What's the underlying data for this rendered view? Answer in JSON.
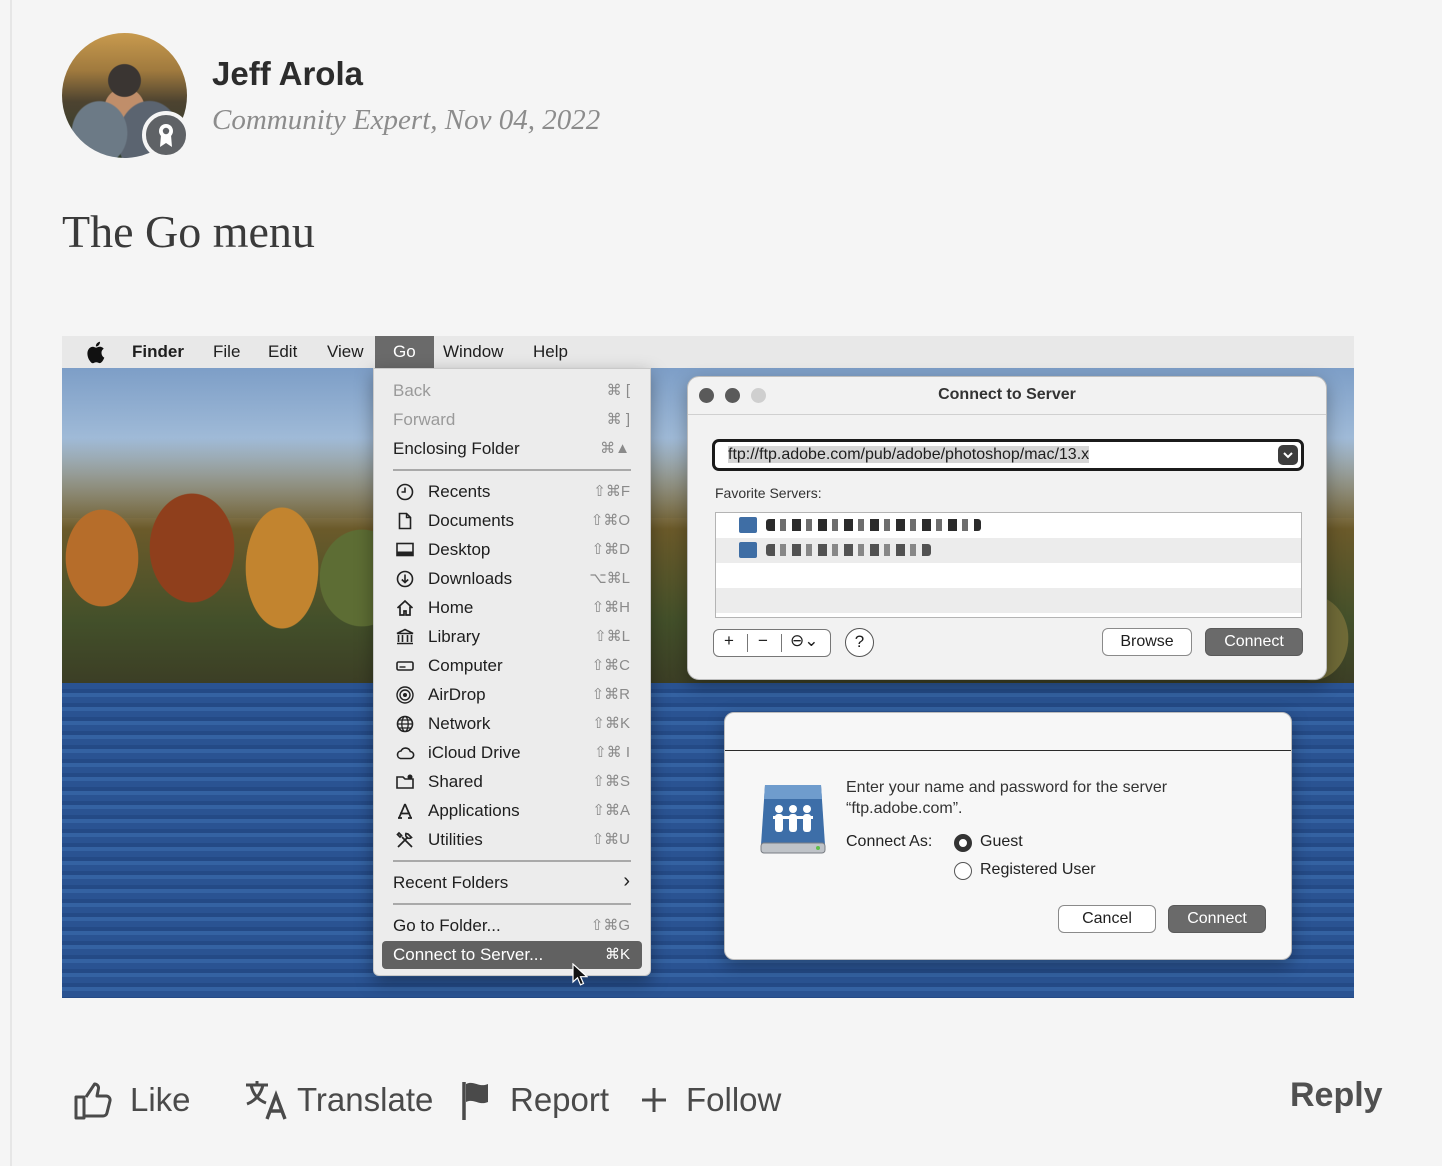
{
  "post": {
    "author_name": "Jeff Arola",
    "author_meta": "Community Expert, Nov 04, 2022",
    "title": "The Go menu"
  },
  "menubar": {
    "app": "Finder",
    "items": [
      "File",
      "Edit",
      "View",
      "Go",
      "Window",
      "Help"
    ],
    "active": "Go"
  },
  "go_menu": {
    "nav": [
      {
        "label": "Back",
        "shortcut": "⌘ [",
        "disabled": true
      },
      {
        "label": "Forward",
        "shortcut": "⌘ ]",
        "disabled": true
      },
      {
        "label": "Enclosing Folder",
        "shortcut": "⌘▲",
        "disabled": false
      }
    ],
    "places": [
      {
        "label": "Recents",
        "shortcut": "⇧⌘F",
        "icon": "clock-icon"
      },
      {
        "label": "Documents",
        "shortcut": "⇧⌘O",
        "icon": "document-icon"
      },
      {
        "label": "Desktop",
        "shortcut": "⇧⌘D",
        "icon": "desktop-icon"
      },
      {
        "label": "Downloads",
        "shortcut": "⌥⌘L",
        "icon": "download-icon"
      },
      {
        "label": "Home",
        "shortcut": "⇧⌘H",
        "icon": "home-icon"
      },
      {
        "label": "Library",
        "shortcut": "⇧⌘L",
        "icon": "library-icon"
      },
      {
        "label": "Computer",
        "shortcut": "⇧⌘C",
        "icon": "computer-icon"
      },
      {
        "label": "AirDrop",
        "shortcut": "⇧⌘R",
        "icon": "airdrop-icon"
      },
      {
        "label": "Network",
        "shortcut": "⇧⌘K",
        "icon": "globe-icon"
      },
      {
        "label": "iCloud Drive",
        "shortcut": "⇧⌘ I",
        "icon": "cloud-icon"
      },
      {
        "label": "Shared",
        "shortcut": "⇧⌘S",
        "icon": "shared-folder-icon"
      },
      {
        "label": "Applications",
        "shortcut": "⇧⌘A",
        "icon": "applications-icon"
      },
      {
        "label": "Utilities",
        "shortcut": "⇧⌘U",
        "icon": "utilities-icon"
      }
    ],
    "recent_folders": {
      "label": "Recent Folders",
      "shortcut": "›"
    },
    "go_to_folder": {
      "label": "Go to Folder...",
      "shortcut": "⇧⌘G"
    },
    "connect_to_server": {
      "label": "Connect to Server...",
      "shortcut": "⌘K"
    }
  },
  "connect_window": {
    "title": "Connect to Server",
    "url": "ftp://ftp.adobe.com/pub/adobe/photoshop/mac/13.x",
    "favorites_label": "Favorite Servers:",
    "tools": {
      "add": "+",
      "remove": "−",
      "more": "⊖⌄"
    },
    "help": "?",
    "browse": "Browse",
    "connect": "Connect"
  },
  "auth_sheet": {
    "message_line1": "Enter your name and password for the server",
    "message_line2": "“ftp.adobe.com”.",
    "connect_as_label": "Connect As:",
    "options": [
      "Guest",
      "Registered User"
    ],
    "selected": "Guest",
    "cancel": "Cancel",
    "connect": "Connect"
  },
  "actions": {
    "like": "Like",
    "translate": "Translate",
    "report": "Report",
    "follow": "Follow",
    "reply": "Reply"
  }
}
